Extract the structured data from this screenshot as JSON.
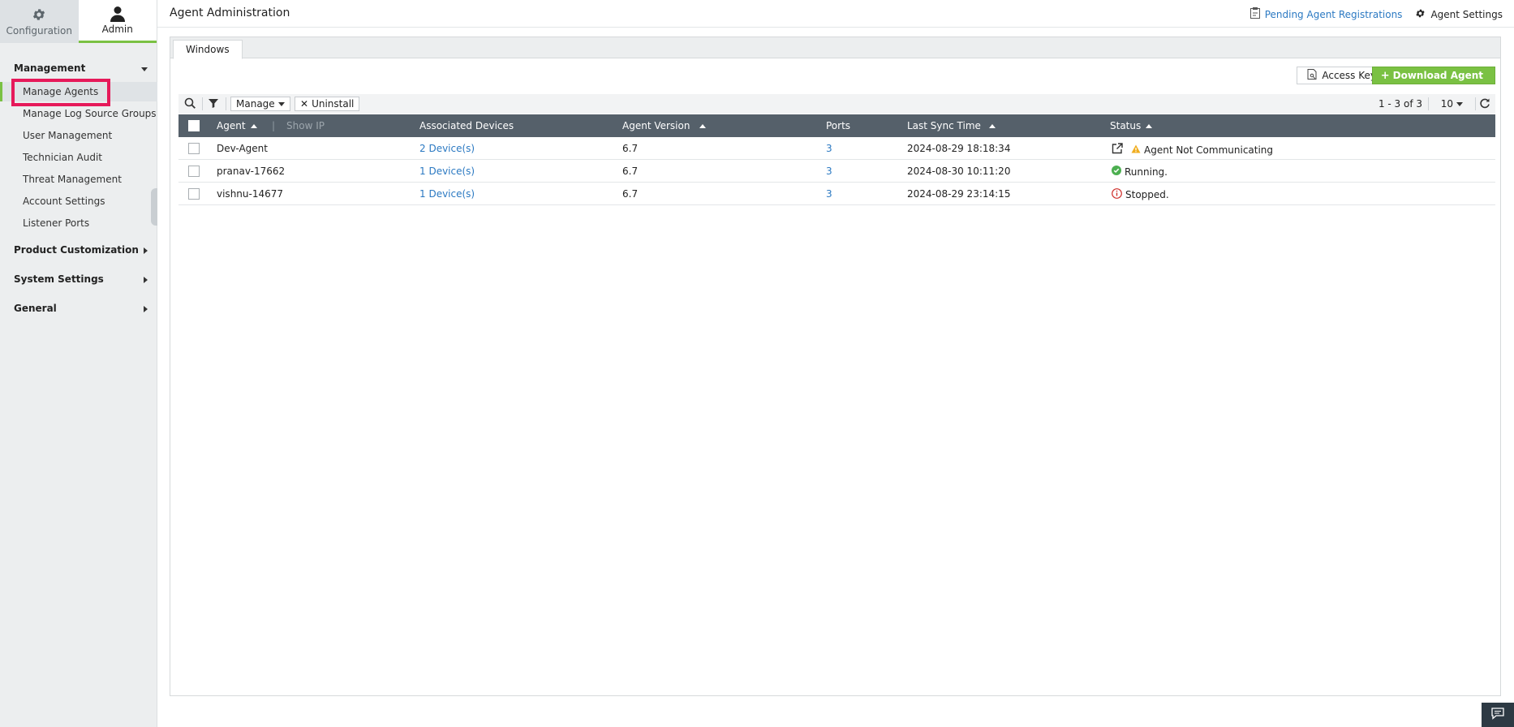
{
  "sidebar": {
    "top_tabs": [
      {
        "label": "Configuration",
        "icon": "gear-icon"
      },
      {
        "label": "Admin",
        "icon": "user-icon"
      }
    ],
    "sections": [
      {
        "label": "Management",
        "expanded": true
      },
      {
        "label": "Product Customization",
        "expanded": false
      },
      {
        "label": "System Settings",
        "expanded": false
      },
      {
        "label": "General",
        "expanded": false
      }
    ],
    "management_items": [
      {
        "label": "Manage Agents",
        "active": true
      },
      {
        "label": "Manage Log Source Groups"
      },
      {
        "label": "User Management"
      },
      {
        "label": "Technician Audit"
      },
      {
        "label": "Threat Management"
      },
      {
        "label": "Account Settings"
      },
      {
        "label": "Listener Ports"
      }
    ]
  },
  "header": {
    "title": "Agent Administration",
    "pending_link": "Pending Agent Registrations",
    "settings_link": "Agent Settings"
  },
  "tabs": [
    "Windows"
  ],
  "actions": {
    "access_key": "Access Key",
    "download_agent": "Download Agent"
  },
  "toolbar": {
    "manage": "Manage",
    "uninstall": "Uninstall",
    "pager": "1 - 3 of 3",
    "page_size": "10"
  },
  "table": {
    "columns": {
      "agent": "Agent",
      "show_ip": "Show IP",
      "devices": "Associated Devices",
      "version": "Agent Version",
      "ports": "Ports",
      "sync": "Last Sync Time",
      "status": "Status"
    },
    "rows": [
      {
        "agent": "Dev-Agent",
        "devices": "2 Device(s)",
        "version": "6.7",
        "ports": "3",
        "sync": "2024-08-29 18:18:34",
        "status": "Agent Not Communicating"
      },
      {
        "agent": "pranav-17662",
        "devices": "1 Device(s)",
        "version": "6.7",
        "ports": "3",
        "sync": "2024-08-30 10:11:20",
        "status": "Running."
      },
      {
        "agent": "vishnu-14677",
        "devices": "1 Device(s)",
        "version": "6.7",
        "ports": "3",
        "sync": "2024-08-29 23:14:15",
        "status": "Stopped."
      }
    ]
  },
  "colors": {
    "accent_green": "#7ac143",
    "link_blue": "#2b79c2",
    "header_gray": "#55606a",
    "highlight_pink": "#e6195a"
  }
}
